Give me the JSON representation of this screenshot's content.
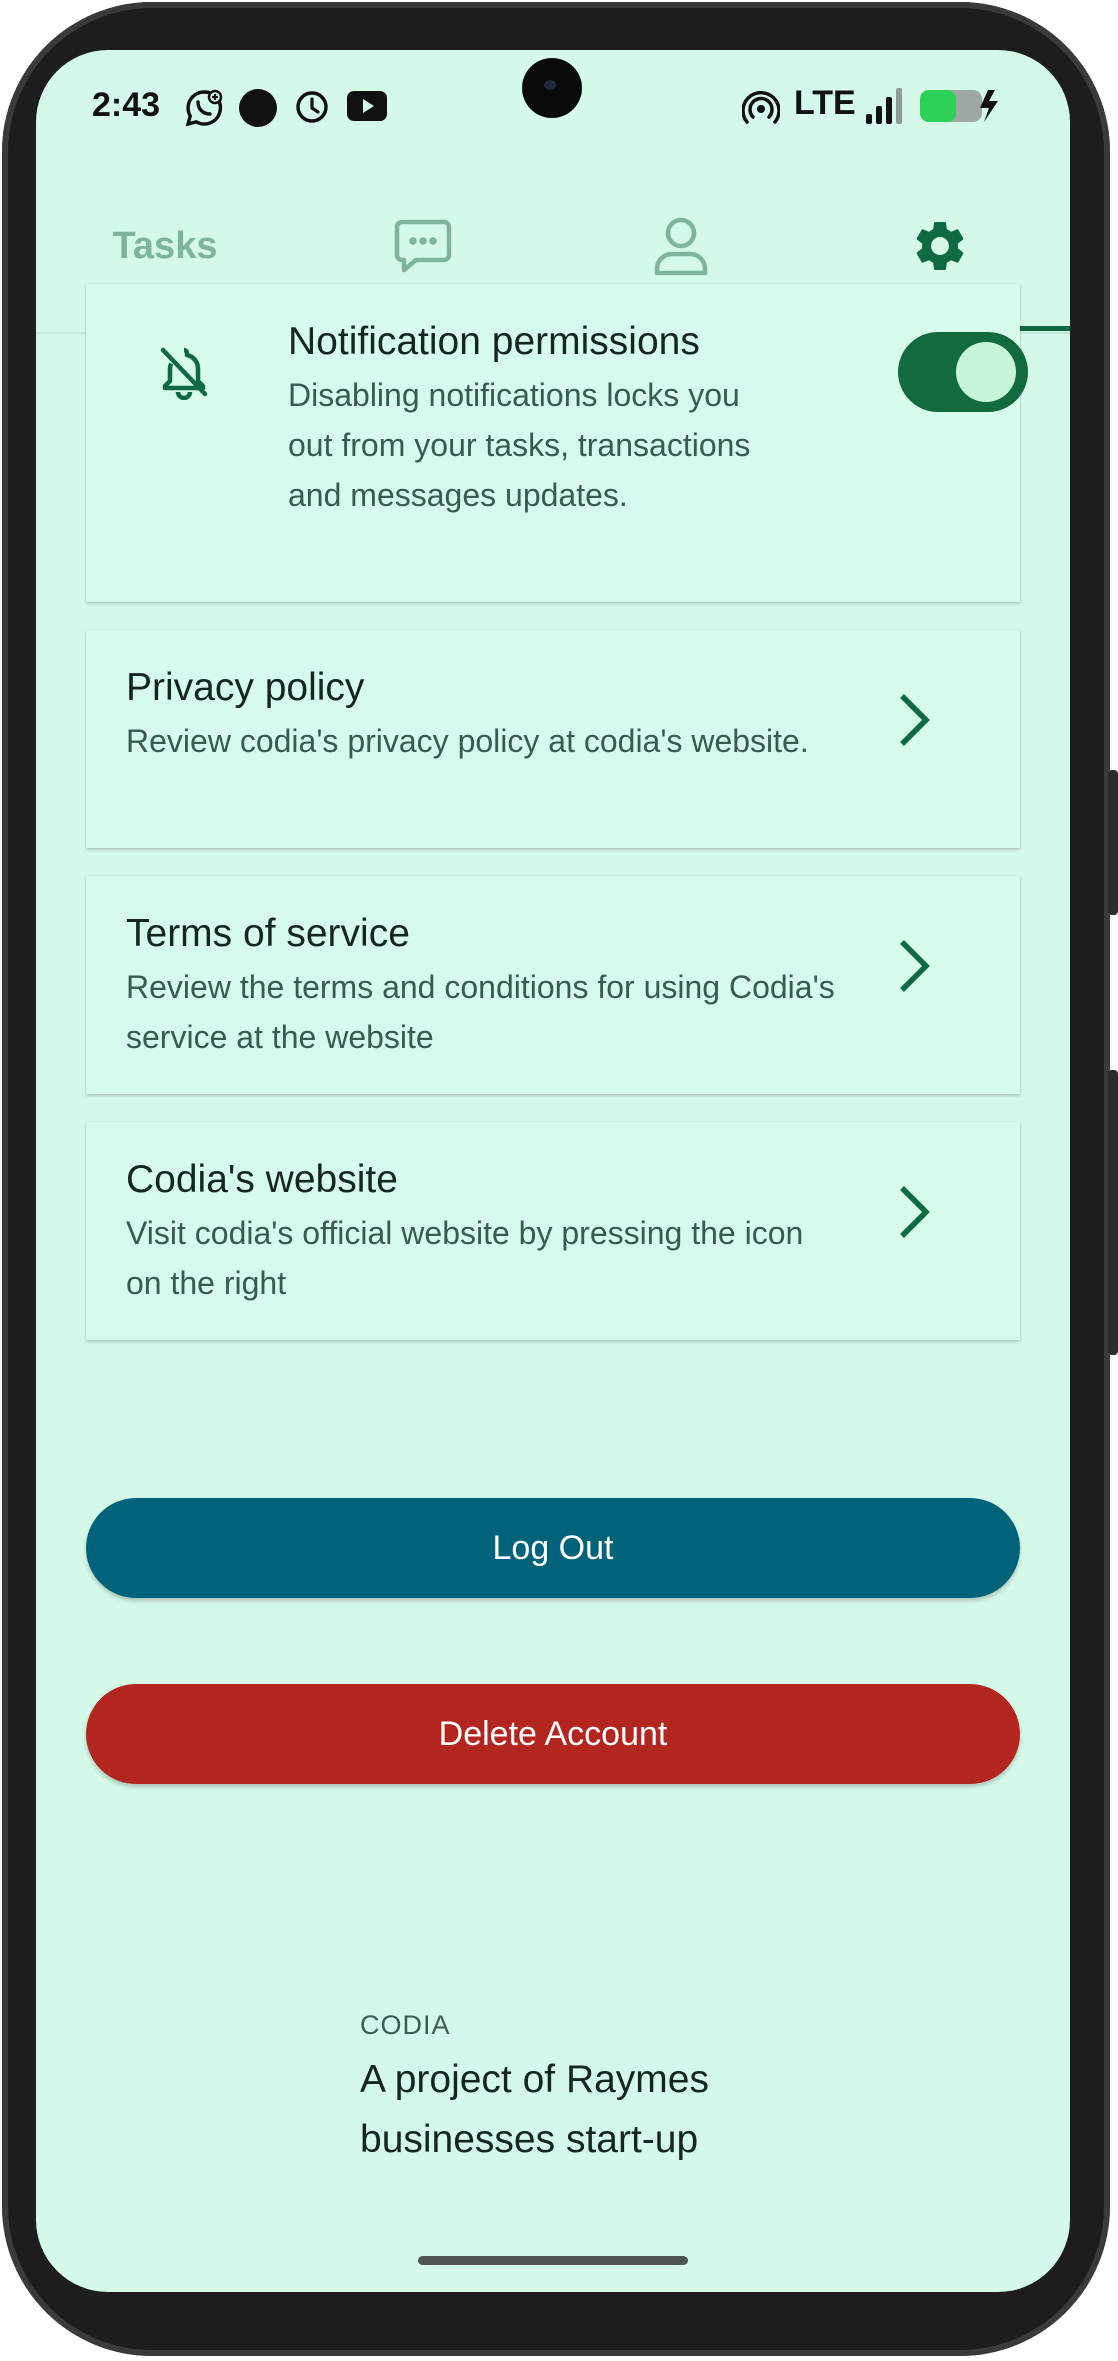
{
  "status_bar": {
    "time": "2:43",
    "network": "LTE",
    "icons": [
      "whatsapp-icon",
      "record-dot-icon",
      "alarm-icon",
      "youtube-icon",
      "hotspot-icon",
      "signal-icon",
      "battery-charging-icon"
    ]
  },
  "tabs": {
    "tasks_label": "Tasks",
    "items": [
      "tasks",
      "messages",
      "profile",
      "settings"
    ],
    "active": "settings"
  },
  "notifications": {
    "title": "Notification permissions",
    "description": "Disabling notifications locks you out from your tasks, transactions and messages updates.",
    "enabled": true
  },
  "links": [
    {
      "title": "Privacy policy",
      "description": "Review codia's privacy policy at codia's website."
    },
    {
      "title": "Terms of service",
      "description": "Review the terms and conditions for using Codia's service at the website"
    },
    {
      "title": "Codia's website",
      "description": "Visit codia's official website by pressing the icon on the right"
    }
  ],
  "actions": {
    "logout_label": "Log Out",
    "delete_label": "Delete Account"
  },
  "footer": {
    "brand": "CODIA",
    "tagline": "A project of Raymes businesses start-up"
  },
  "colors": {
    "background": "#d5f9e9",
    "accent": "#0f6a43",
    "logout": "#00637a",
    "delete": "#b3261f"
  }
}
